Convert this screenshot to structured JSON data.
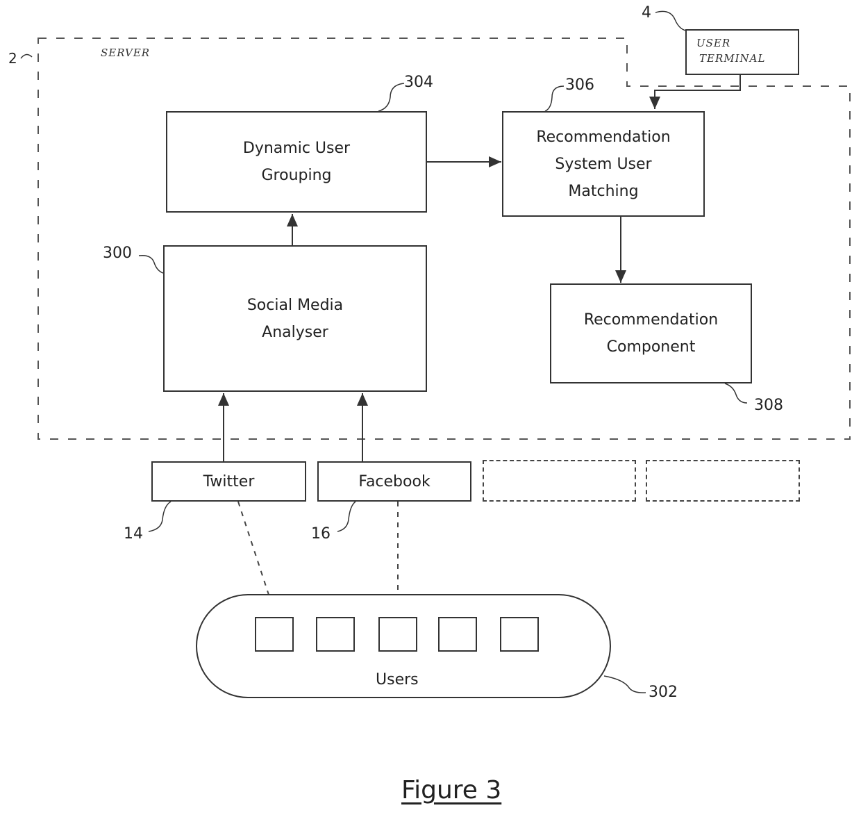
{
  "figure": {
    "caption": "Figure 3"
  },
  "server": {
    "label": "SERVER",
    "ref": "2"
  },
  "user_terminal": {
    "label_line1": "USER",
    "label_line2": "TERMINAL",
    "ref": "4"
  },
  "blocks": {
    "dynamic_user_grouping": {
      "line1": "Dynamic User",
      "line2": "Grouping",
      "ref": "304"
    },
    "recommendation_matching": {
      "line1": "Recommendation",
      "line2": "System User",
      "line3": "Matching",
      "ref": "306"
    },
    "social_media_analyser": {
      "line1": "Social Media",
      "line2": "Analyser",
      "ref": "300"
    },
    "recommendation_component": {
      "line1": "Recommendation",
      "line2": "Component",
      "ref": "308"
    }
  },
  "sources": [
    {
      "label": "Twitter",
      "ref": "14"
    },
    {
      "label": "Facebook",
      "ref": "16"
    }
  ],
  "users": {
    "label": "Users",
    "ref": "302",
    "count": 5
  }
}
